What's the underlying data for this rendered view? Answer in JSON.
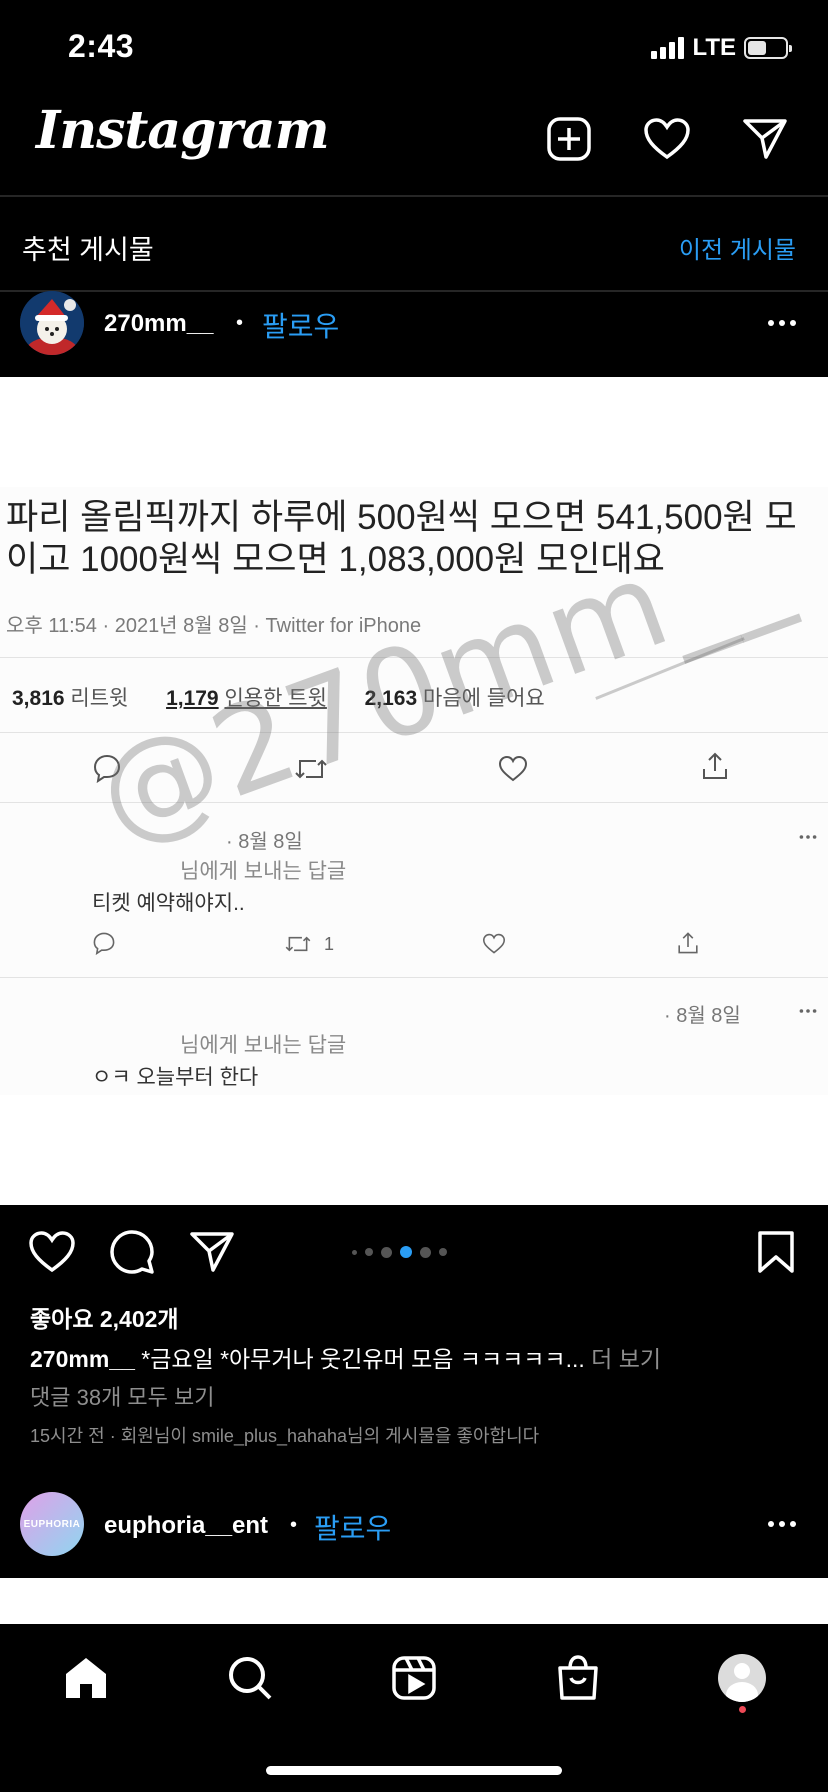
{
  "status_bar": {
    "time": "2:43",
    "network": "LTE"
  },
  "header": {
    "logo": "Instagram",
    "icons": [
      "plus-square-icon",
      "heart-icon",
      "send-icon"
    ]
  },
  "suggested": {
    "title": "추천 게시물",
    "previous_posts": "이전 게시물"
  },
  "post": {
    "username": "270mm__",
    "follow_label": "팔로우",
    "image": {
      "tweet_text_line1": "파리 올림픽까지 하루에 500원씩 모으면 541,500원 모",
      "tweet_text_line2": "이고 1000원씩 모으면 1,083,000원 모인대요",
      "meta": "오후 11:54 · 2021년 8월 8일 · Twitter for iPhone",
      "retweets_count": "3,816",
      "retweets_label": "리트윗",
      "quotes_count": "1,179",
      "quotes_label": "인용한 트윗",
      "likes_count": "2,163",
      "likes_label": "마음에 들어요",
      "reply1_date": "· 8월 8일",
      "reply1_to": "님에게 보내는 답글",
      "reply1_text": "티켓 예약해야지..",
      "reply1_retweets": "1",
      "reply2_date": "· 8월 8일",
      "reply2_to": "님에게 보내는 답글",
      "reply2_text": "ㅇㅋ 오늘부터 한다",
      "watermark": "@270mm__"
    },
    "carousel": {
      "count": 5,
      "active_index": 2
    },
    "likes": "좋아요 2,402개",
    "caption_user": "270mm__",
    "caption_text": "*금요일 *아무거나 웃긴유머 모음 ㅋㅋㅋㅋㅋ...",
    "caption_more": "더 보기",
    "comments_link": "댓글 38개 모두 보기",
    "activity": "15시간 전 · 회원님이 smile_plus_hahaha님의 게시물을 좋아합니다"
  },
  "next_post": {
    "username": "euphoria__ent",
    "follow_label": "팔로우",
    "avatar_text": "EUPHORIA"
  },
  "bottom_nav": [
    "home-icon",
    "search-icon",
    "reels-icon",
    "shop-icon",
    "profile-avatar"
  ],
  "colors": {
    "link_blue": "#2a9df4",
    "background": "#000000",
    "notification_red": "#ed4956"
  }
}
